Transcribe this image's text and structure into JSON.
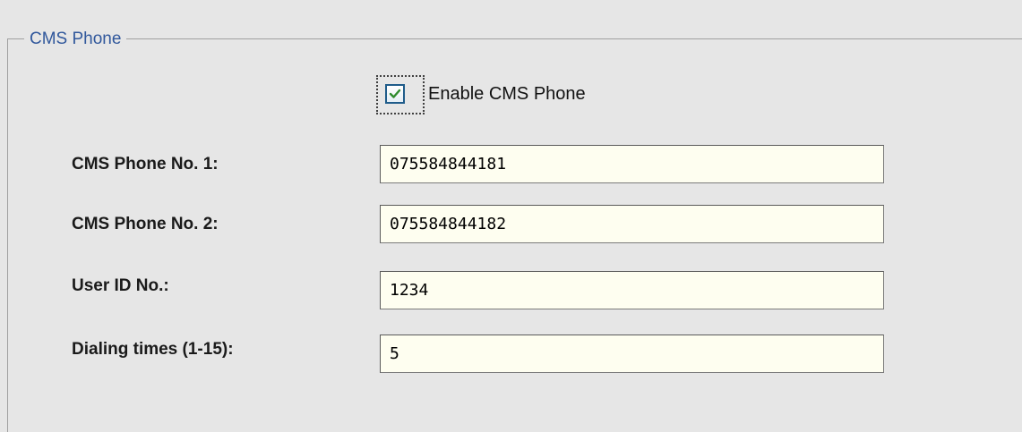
{
  "group": {
    "title": "CMS Phone"
  },
  "enable_checkbox": {
    "label": "Enable CMS Phone",
    "checked": true,
    "check_color": "#2e8b2e"
  },
  "fields": [
    {
      "label": "CMS Phone No. 1:",
      "value": "075584844181"
    },
    {
      "label": "CMS Phone No. 2:",
      "value": "075584844182"
    },
    {
      "label": "User ID No.:",
      "value": "1234"
    },
    {
      "label": "Dialing times (1-15):",
      "value": "5"
    }
  ],
  "colors": {
    "background": "#e6e6e6",
    "input_background": "#fefef0",
    "title_color": "#31589c"
  }
}
